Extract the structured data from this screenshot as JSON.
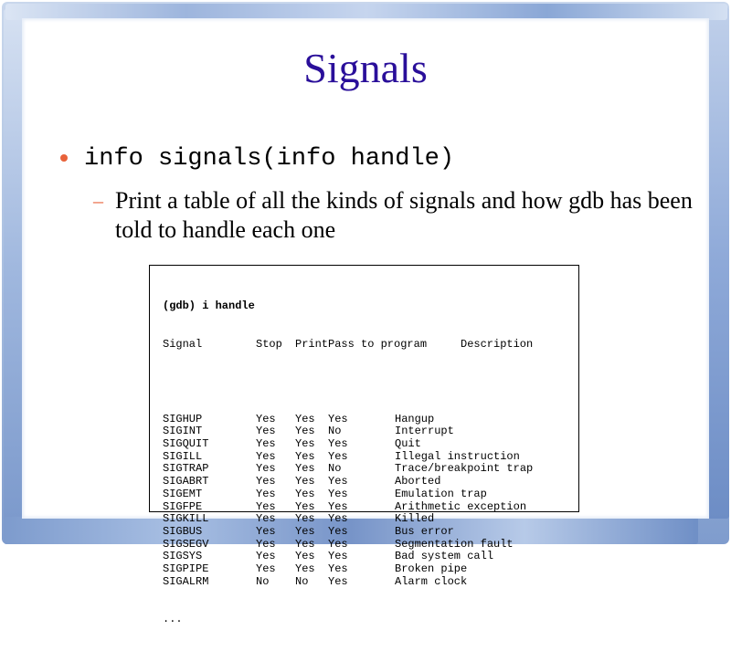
{
  "slide": {
    "title": "Signals",
    "bullet": "info signals(info handle)",
    "sub_bullet": "Print a table of all the kinds of signals and how gdb has been told to handle each one"
  },
  "code": {
    "command": "(gdb) i handle",
    "headers": {
      "signal": "Signal",
      "stop": "Stop",
      "print": "Print",
      "pass": "Pass to program",
      "description": "Description"
    },
    "rows": [
      {
        "signal": "SIGHUP",
        "stop": "Yes",
        "print": "Yes",
        "pass": "Yes",
        "description": "Hangup"
      },
      {
        "signal": "SIGINT",
        "stop": "Yes",
        "print": "Yes",
        "pass": "No",
        "description": "Interrupt"
      },
      {
        "signal": "SIGQUIT",
        "stop": "Yes",
        "print": "Yes",
        "pass": "Yes",
        "description": "Quit"
      },
      {
        "signal": "SIGILL",
        "stop": "Yes",
        "print": "Yes",
        "pass": "Yes",
        "description": "Illegal instruction"
      },
      {
        "signal": "SIGTRAP",
        "stop": "Yes",
        "print": "Yes",
        "pass": "No",
        "description": "Trace/breakpoint trap"
      },
      {
        "signal": "SIGABRT",
        "stop": "Yes",
        "print": "Yes",
        "pass": "Yes",
        "description": "Aborted"
      },
      {
        "signal": "SIGEMT",
        "stop": "Yes",
        "print": "Yes",
        "pass": "Yes",
        "description": "Emulation trap"
      },
      {
        "signal": "SIGFPE",
        "stop": "Yes",
        "print": "Yes",
        "pass": "Yes",
        "description": "Arithmetic exception"
      },
      {
        "signal": "SIGKILL",
        "stop": "Yes",
        "print": "Yes",
        "pass": "Yes",
        "description": "Killed"
      },
      {
        "signal": "SIGBUS",
        "stop": "Yes",
        "print": "Yes",
        "pass": "Yes",
        "description": "Bus error"
      },
      {
        "signal": "SIGSEGV",
        "stop": "Yes",
        "print": "Yes",
        "pass": "Yes",
        "description": "Segmentation fault"
      },
      {
        "signal": "SIGSYS",
        "stop": "Yes",
        "print": "Yes",
        "pass": "Yes",
        "description": "Bad system call"
      },
      {
        "signal": "SIGPIPE",
        "stop": "Yes",
        "print": "Yes",
        "pass": "Yes",
        "description": "Broken pipe"
      },
      {
        "signal": "SIGALRM",
        "stop": "No",
        "print": "No",
        "pass": "Yes",
        "description": "Alarm clock"
      }
    ],
    "ellipsis": "..."
  },
  "colors": {
    "title": "#2a0f9a",
    "bullet_accent": "#e8623a",
    "frame": "#8aa7d6"
  }
}
